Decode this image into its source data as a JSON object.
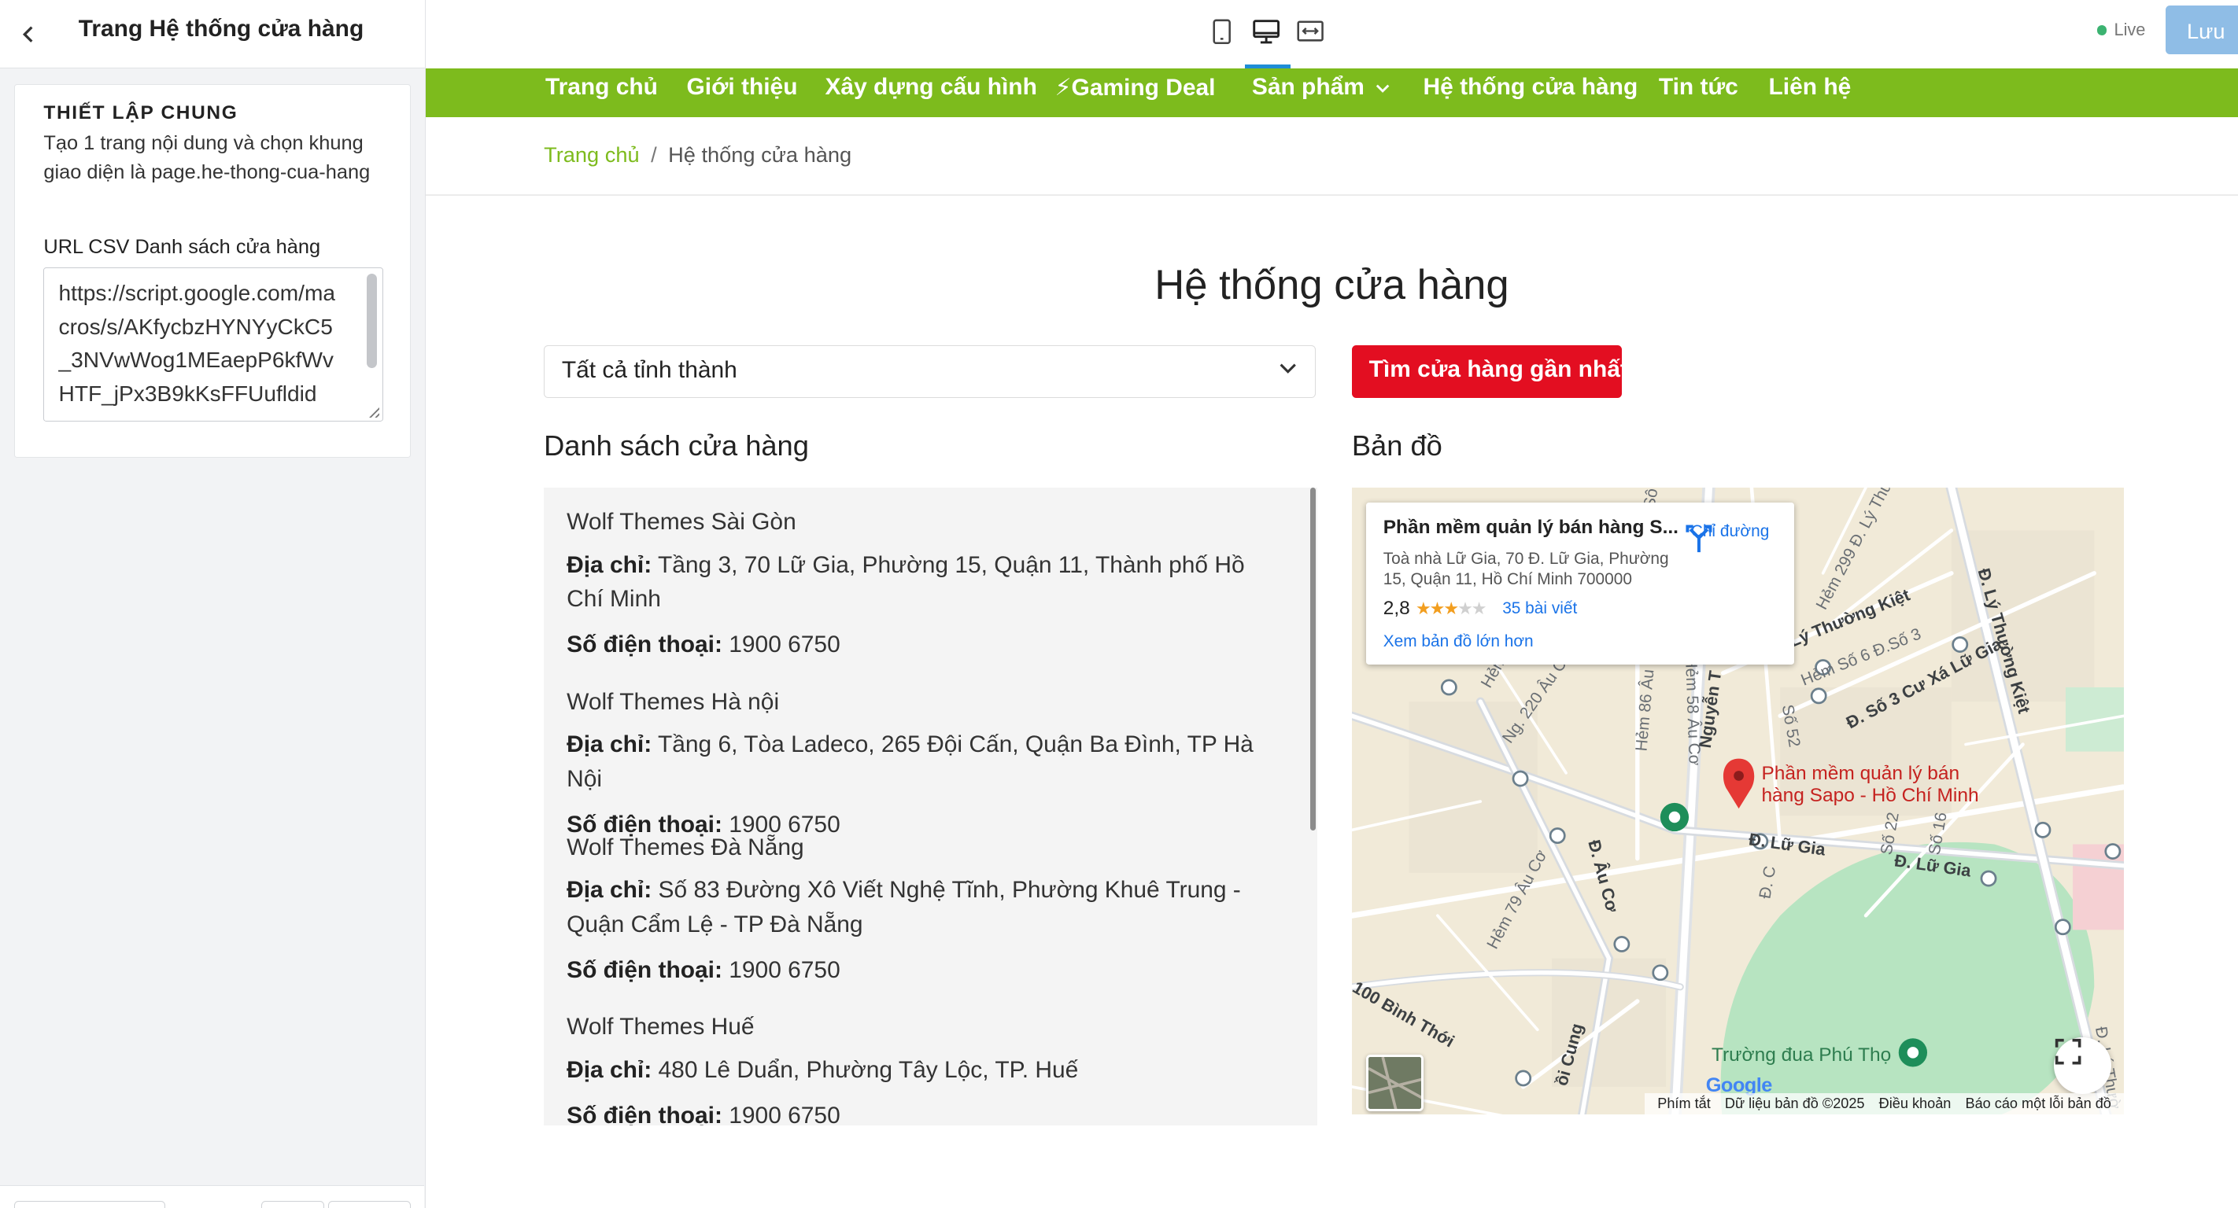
{
  "sidebar": {
    "title": "Trang Hệ thống cửa hàng",
    "card": {
      "heading": "THIẾT LẬP CHUNG",
      "description": "Tạo 1 trang nội dung và chọn khung giao diện là page.he-thong-cua-hang",
      "csv_label": "URL CSV Danh sách cửa hàng",
      "csv_value": "https://script.google.com/macros/s/AKfycbzHYNYyCkC5_3NVwWog1MEaepP6kfWvHTF_jPx3B9kKsFFUufldid"
    }
  },
  "toolbar": {
    "live_label": "Live",
    "save_label": "Lưu",
    "active_device": "desktop"
  },
  "site": {
    "nav": [
      "Trang chủ",
      "Giới thiệu",
      "Xây dựng cấu hình",
      "⚡Gaming Deal",
      "Sản phẩm",
      "Hệ thống cửa hàng",
      "Tin tức",
      "Liên hệ"
    ],
    "breadcrumb": {
      "home": "Trang chủ",
      "current": "Hệ thống cửa hàng"
    },
    "page_title": "Hệ thống cửa hàng",
    "province_select": "Tất cả tỉnh thành",
    "find_nearest": "Tìm cửa hàng gần nhất",
    "list_title": "Danh sách cửa hàng",
    "map_title": "Bản đồ",
    "address_label": "Địa chỉ:",
    "phone_label": "Số điện thoại:",
    "stores": [
      {
        "name": "Wolf Themes Sài Gòn",
        "address": "Tầng 3, 70 Lữ Gia, Phường 15, Quận 11, Thành phố Hồ Chí Minh",
        "phone": "1900 6750"
      },
      {
        "name": "Wolf Themes Hà nội",
        "address": "Tầng 6, Tòa Ladeco, 265 Đội Cấn, Quận Ba Đình, TP Hà Nội",
        "phone": "1900 6750"
      },
      {
        "name": "Wolf Themes Đà Nẵng",
        "address": "Số 83 Đường Xô Viết Nghệ Tĩnh, Phường Khuê Trung - Quận Cẩm Lệ - TP Đà Nẵng",
        "phone": "1900 6750"
      },
      {
        "name": "Wolf Themes Huế",
        "address": "480 Lê Duẩn, Phường Tây Lộc, TP. Huế",
        "phone": "1900 6750"
      }
    ]
  },
  "map": {
    "place_title": "Phần mềm quản lý bán hàng S...",
    "place_address": "Toà nhà Lữ Gia, 70 Đ. Lữ Gia, Phường 15, Quận 11, Hồ Chí Minh 700000",
    "rating": "2,8",
    "rating_stars": 3,
    "reviews": "35 bài viết",
    "directions": "Chỉ đường",
    "view_larger": "Xem bản đồ lớn hơn",
    "pin_label": "Phần mềm quản lý bán hàng Sapo - Hồ Chí Minh",
    "poi_label": "Trường đua Phú Thọ",
    "google": "Google",
    "attribution": [
      "Phím tắt",
      "Dữ liệu bản đồ ©2025",
      "Điều khoản",
      "Báo cáo một lỗi bản đồ"
    ],
    "streets": {
      "ly_thuong_kiet": "Lý Thường Kiệt",
      "d_ly_thuong_kiet": "Đ. Lý Thường Kiệt",
      "lu_gia_1": "Đ. Lữ Gia",
      "lu_gia_2": "Đ. Lữ Gia",
      "au_co": "Đ. Âu Cơ",
      "so3": "Đ. Số 3 Cư Xá Lữ Gia",
      "nguyen": "Nguyễn T",
      "binh_thoi": "100 Bình Thới",
      "hem220": "Ng. 220 Âu Cơ",
      "hem86": "Hẻm 86 Âu Cơ",
      "hem58": "Hẻm 58 Âu Cơ",
      "so52": "Số 52",
      "hem79": "Hẻm 79 Âu Cơ",
      "hem299": "Hẻm 299 Đ. Lý Thườ",
      "hem6": "Hẻm Số 6 Đ.Số 3",
      "so22": "Số 22",
      "so16": "Số 16",
      "dc": "Đ. C",
      "hem_so": "Hẻm",
      "oi_cung": "ồi Cung",
      "d_ly_thuo": "Đ. Lý Thườ",
      "dso": "Đ. Sô"
    }
  }
}
